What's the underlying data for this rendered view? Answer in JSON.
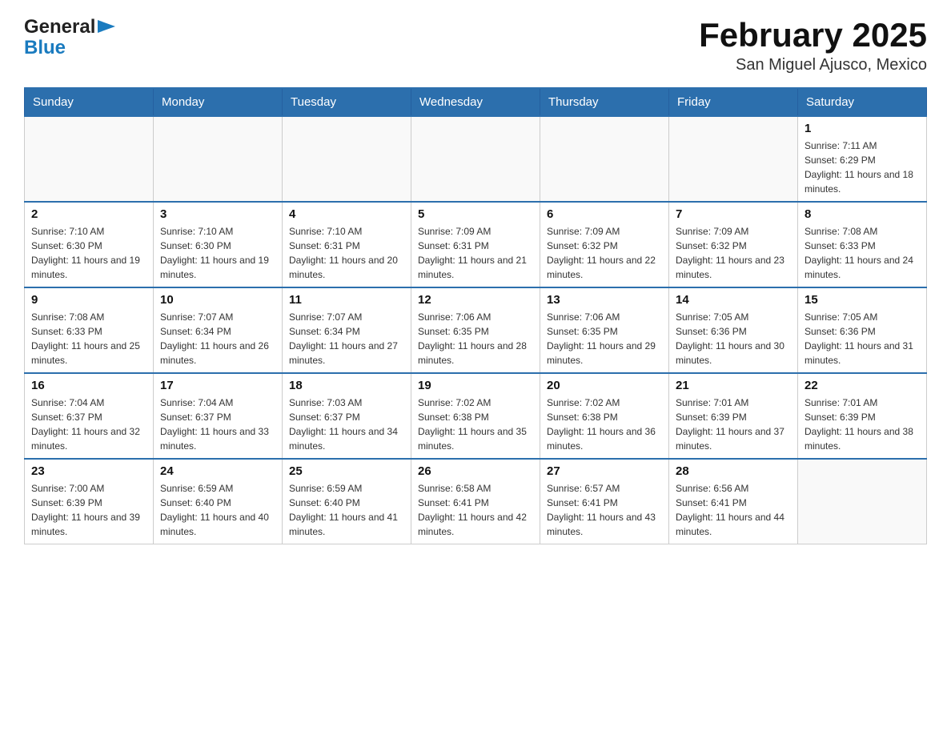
{
  "header": {
    "logo_line1": "General",
    "logo_line2": "Blue",
    "month_title": "February 2025",
    "location": "San Miguel Ajusco, Mexico"
  },
  "days_of_week": [
    "Sunday",
    "Monday",
    "Tuesday",
    "Wednesday",
    "Thursday",
    "Friday",
    "Saturday"
  ],
  "weeks": [
    [
      {
        "day": "",
        "info": ""
      },
      {
        "day": "",
        "info": ""
      },
      {
        "day": "",
        "info": ""
      },
      {
        "day": "",
        "info": ""
      },
      {
        "day": "",
        "info": ""
      },
      {
        "day": "",
        "info": ""
      },
      {
        "day": "1",
        "info": "Sunrise: 7:11 AM\nSunset: 6:29 PM\nDaylight: 11 hours and 18 minutes."
      }
    ],
    [
      {
        "day": "2",
        "info": "Sunrise: 7:10 AM\nSunset: 6:30 PM\nDaylight: 11 hours and 19 minutes."
      },
      {
        "day": "3",
        "info": "Sunrise: 7:10 AM\nSunset: 6:30 PM\nDaylight: 11 hours and 19 minutes."
      },
      {
        "day": "4",
        "info": "Sunrise: 7:10 AM\nSunset: 6:31 PM\nDaylight: 11 hours and 20 minutes."
      },
      {
        "day": "5",
        "info": "Sunrise: 7:09 AM\nSunset: 6:31 PM\nDaylight: 11 hours and 21 minutes."
      },
      {
        "day": "6",
        "info": "Sunrise: 7:09 AM\nSunset: 6:32 PM\nDaylight: 11 hours and 22 minutes."
      },
      {
        "day": "7",
        "info": "Sunrise: 7:09 AM\nSunset: 6:32 PM\nDaylight: 11 hours and 23 minutes."
      },
      {
        "day": "8",
        "info": "Sunrise: 7:08 AM\nSunset: 6:33 PM\nDaylight: 11 hours and 24 minutes."
      }
    ],
    [
      {
        "day": "9",
        "info": "Sunrise: 7:08 AM\nSunset: 6:33 PM\nDaylight: 11 hours and 25 minutes."
      },
      {
        "day": "10",
        "info": "Sunrise: 7:07 AM\nSunset: 6:34 PM\nDaylight: 11 hours and 26 minutes."
      },
      {
        "day": "11",
        "info": "Sunrise: 7:07 AM\nSunset: 6:34 PM\nDaylight: 11 hours and 27 minutes."
      },
      {
        "day": "12",
        "info": "Sunrise: 7:06 AM\nSunset: 6:35 PM\nDaylight: 11 hours and 28 minutes."
      },
      {
        "day": "13",
        "info": "Sunrise: 7:06 AM\nSunset: 6:35 PM\nDaylight: 11 hours and 29 minutes."
      },
      {
        "day": "14",
        "info": "Sunrise: 7:05 AM\nSunset: 6:36 PM\nDaylight: 11 hours and 30 minutes."
      },
      {
        "day": "15",
        "info": "Sunrise: 7:05 AM\nSunset: 6:36 PM\nDaylight: 11 hours and 31 minutes."
      }
    ],
    [
      {
        "day": "16",
        "info": "Sunrise: 7:04 AM\nSunset: 6:37 PM\nDaylight: 11 hours and 32 minutes."
      },
      {
        "day": "17",
        "info": "Sunrise: 7:04 AM\nSunset: 6:37 PM\nDaylight: 11 hours and 33 minutes."
      },
      {
        "day": "18",
        "info": "Sunrise: 7:03 AM\nSunset: 6:37 PM\nDaylight: 11 hours and 34 minutes."
      },
      {
        "day": "19",
        "info": "Sunrise: 7:02 AM\nSunset: 6:38 PM\nDaylight: 11 hours and 35 minutes."
      },
      {
        "day": "20",
        "info": "Sunrise: 7:02 AM\nSunset: 6:38 PM\nDaylight: 11 hours and 36 minutes."
      },
      {
        "day": "21",
        "info": "Sunrise: 7:01 AM\nSunset: 6:39 PM\nDaylight: 11 hours and 37 minutes."
      },
      {
        "day": "22",
        "info": "Sunrise: 7:01 AM\nSunset: 6:39 PM\nDaylight: 11 hours and 38 minutes."
      }
    ],
    [
      {
        "day": "23",
        "info": "Sunrise: 7:00 AM\nSunset: 6:39 PM\nDaylight: 11 hours and 39 minutes."
      },
      {
        "day": "24",
        "info": "Sunrise: 6:59 AM\nSunset: 6:40 PM\nDaylight: 11 hours and 40 minutes."
      },
      {
        "day": "25",
        "info": "Sunrise: 6:59 AM\nSunset: 6:40 PM\nDaylight: 11 hours and 41 minutes."
      },
      {
        "day": "26",
        "info": "Sunrise: 6:58 AM\nSunset: 6:41 PM\nDaylight: 11 hours and 42 minutes."
      },
      {
        "day": "27",
        "info": "Sunrise: 6:57 AM\nSunset: 6:41 PM\nDaylight: 11 hours and 43 minutes."
      },
      {
        "day": "28",
        "info": "Sunrise: 6:56 AM\nSunset: 6:41 PM\nDaylight: 11 hours and 44 minutes."
      },
      {
        "day": "",
        "info": ""
      }
    ]
  ]
}
